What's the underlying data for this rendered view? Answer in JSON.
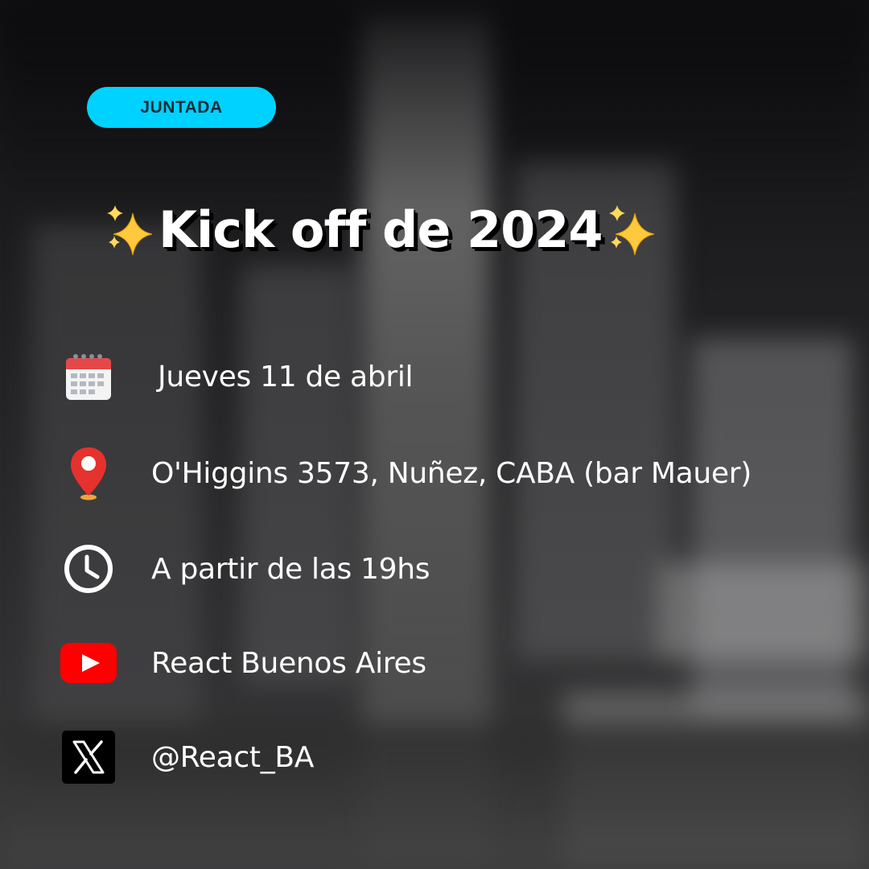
{
  "badge": {
    "label": "JUNTADA",
    "color": "#00d2ff"
  },
  "title": {
    "text": "Kick off de 2024",
    "decoration": "sparkles-emoji"
  },
  "details": [
    {
      "icon": "calendar-icon",
      "text": "Jueves 11 de abril"
    },
    {
      "icon": "location-pin-icon",
      "text": "O'Higgins 3573, Nuñez, CABA (bar Mauer)"
    },
    {
      "icon": "clock-icon",
      "text": "A partir de las 19hs"
    },
    {
      "icon": "youtube-icon",
      "text": "React Buenos Aires"
    },
    {
      "icon": "x-logo-icon",
      "text": "@React_BA"
    }
  ]
}
